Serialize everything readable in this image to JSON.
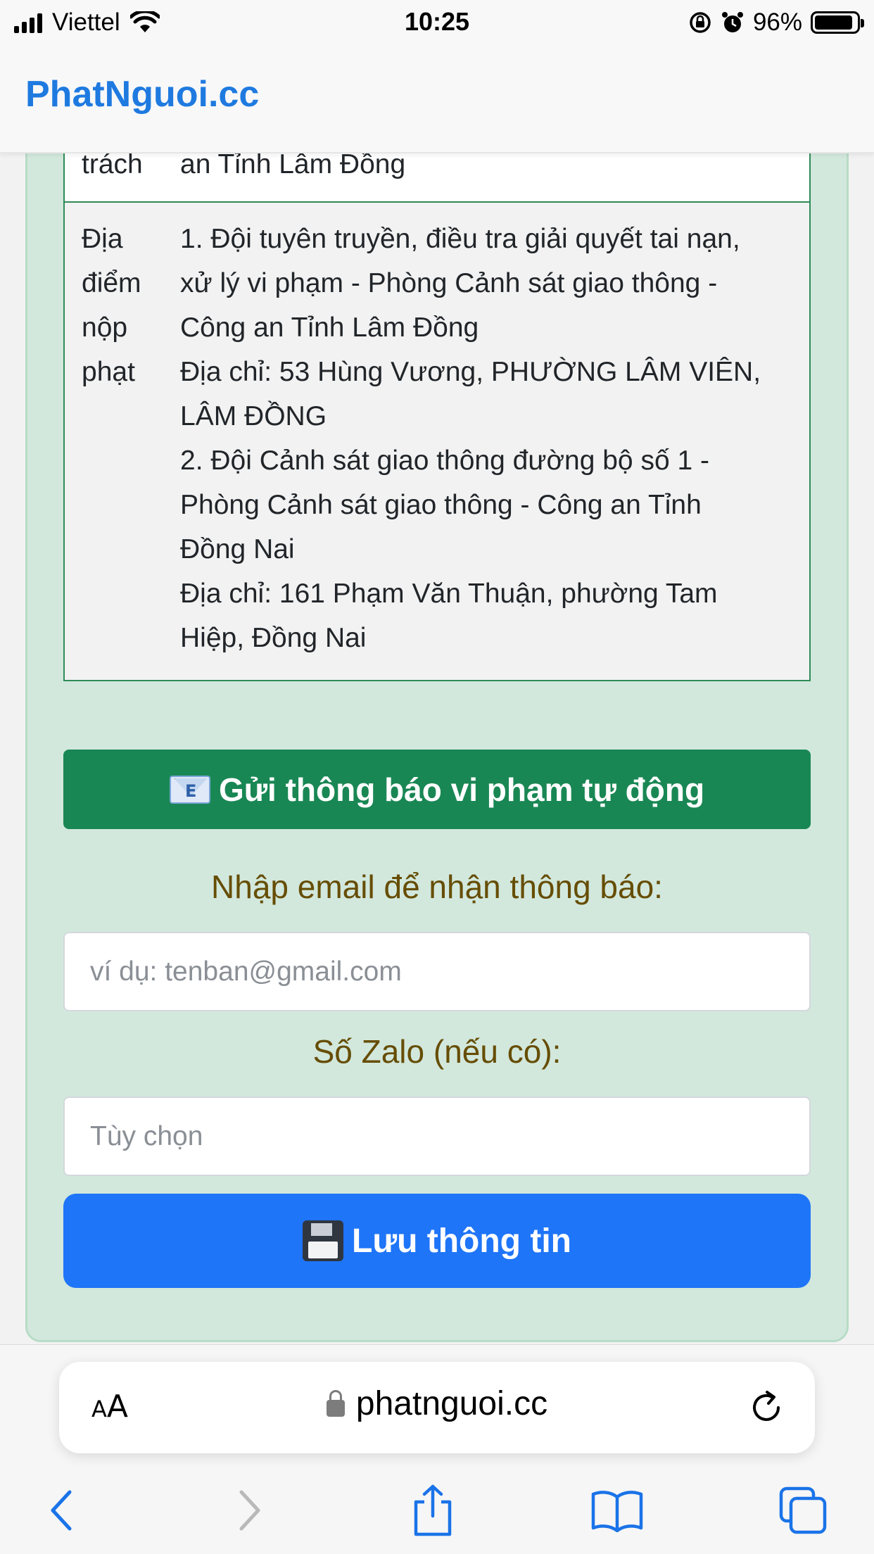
{
  "status_bar": {
    "carrier": "Viettel",
    "time": "10:25",
    "battery": "96%"
  },
  "site": {
    "brand": "PhatNguoi.cc"
  },
  "info_table": {
    "partial_row": {
      "label": "trách",
      "value": "an Tỉnh Lâm Đồng"
    },
    "payment_location": {
      "label": [
        "Địa",
        "điểm",
        "nộp",
        "phạt"
      ],
      "lines": [
        "1. Đội tuyên truyền, điều tra giải quyết tai nạn,",
        "xử lý vi phạm - Phòng Cảnh sát giao thông -",
        "Công an Tỉnh Lâm Đồng",
        "Địa chỉ: 53 Hùng Vương, PHƯỜNG LÂM VIÊN,",
        "LÂM ĐỒNG",
        "2. Đội Cảnh sát giao thông đường bộ số 1 -",
        "Phòng Cảnh sát giao thông - Công an Tỉnh",
        "Đồng Nai",
        "Địa chỉ: 161 Phạm Văn Thuận, phường Tam",
        "Hiệp, Đồng Nai"
      ]
    }
  },
  "notify": {
    "button_label": "Gửi thông báo vi phạm tự động",
    "email_label": "Nhập email để nhận thông báo:",
    "email_placeholder": "ví dụ: tenban@gmail.com",
    "zalo_label": "Số Zalo (nếu có):",
    "zalo_placeholder": "Tùy chọn",
    "save_label": "Lưu thông tin"
  },
  "browser": {
    "aa_small": "A",
    "aa_big": "A",
    "url": "phatnguoi.cc"
  },
  "colors": {
    "brand": "#1f7ae0",
    "card_bg": "#d2e8dd",
    "notify_button": "#198754",
    "save_button": "#1f75f8",
    "label_text": "#664d03"
  },
  "icons": {
    "notify": "envelope-e-mail-icon",
    "save": "floppy-disk-icon",
    "toolbar": [
      "back-icon",
      "forward-icon",
      "share-icon",
      "bookmarks-icon",
      "tabs-icon"
    ]
  }
}
